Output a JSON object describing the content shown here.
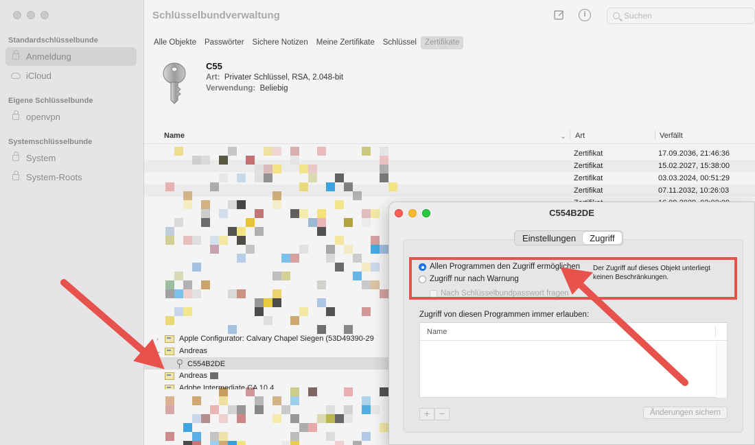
{
  "sidebar": {
    "sections": [
      {
        "title": "Standardschlüsselbunde",
        "items": [
          {
            "label": "Anmeldung",
            "active": true,
            "icon": "lock-icon"
          },
          {
            "label": "iCloud",
            "active": false,
            "icon": "cloud-icon"
          }
        ]
      },
      {
        "title": "Eigene Schlüsselbunde",
        "items": [
          {
            "label": "openvpn",
            "active": false,
            "icon": "lock-icon"
          }
        ]
      },
      {
        "title": "Systemschlüsselbunde",
        "items": [
          {
            "label": "System",
            "active": false,
            "icon": "lock-icon"
          },
          {
            "label": "System-Roots",
            "active": false,
            "icon": "safe-icon"
          }
        ]
      }
    ]
  },
  "header": {
    "title": "Schlüsselbundverwaltung",
    "search_placeholder": "Suchen",
    "icons": [
      "compose-icon",
      "info-icon",
      "search-icon"
    ]
  },
  "tabs": [
    "Alle Objekte",
    "Passwörter",
    "Sichere Notizen",
    "Meine Zertifikate",
    "Schlüssel",
    "Zertifikate"
  ],
  "active_tab": "Zertifikate",
  "detail": {
    "name": "C55",
    "art_label": "Art:",
    "art_value": "Privater Schlüssel, RSA, 2.048-bit",
    "use_label": "Verwendung:",
    "use_value": "Beliebig"
  },
  "columns": {
    "name": "Name",
    "art": "Art",
    "expires": "Verfällt"
  },
  "rows": [
    {
      "art": "Zertifikat",
      "expires": "17.09.2036, 21:46:36"
    },
    {
      "art": "Zertifikat",
      "expires": "15.02.2027, 15:38:00"
    },
    {
      "art": "Zertifikat",
      "expires": "03.03.2024, 00:51:29"
    },
    {
      "art": "Zertifikat",
      "expires": "07.11.2032, 10:26:03"
    },
    {
      "art": "Zertifikat",
      "expires": "16.09.2028, 02:00:00"
    }
  ],
  "tree": {
    "configurator": "Apple Configurator: Calvary Chapel Siegen (53D49390-29",
    "andreas": "Andreas",
    "key": "C554B2DE",
    "andreas2": "Andreas",
    "partial": "Adobe Intermediate CA 10.4"
  },
  "dialog": {
    "title": "C554B2DE",
    "tabs": [
      "Einstellungen",
      "Zugriff"
    ],
    "active_tab": "Zugriff",
    "radio_all": "Allen Programmen den Zugriff ermöglichen",
    "radio_warn": "Zugriff nur nach Warnung",
    "checkbox": "Nach Schlüsselbundpasswort fragen",
    "note_line1": "Der Zugriff auf dieses Objekt unterliegt",
    "note_line2": "keinen Beschränkungen.",
    "always_label": "Zugriff von diesen Programmen immer erlauben:",
    "table_header": "Name",
    "plus": "+",
    "minus": "−",
    "save": "Änderungen sichern"
  },
  "colors": {
    "accent": "#1c79f0",
    "annotation": "#e8524d"
  }
}
